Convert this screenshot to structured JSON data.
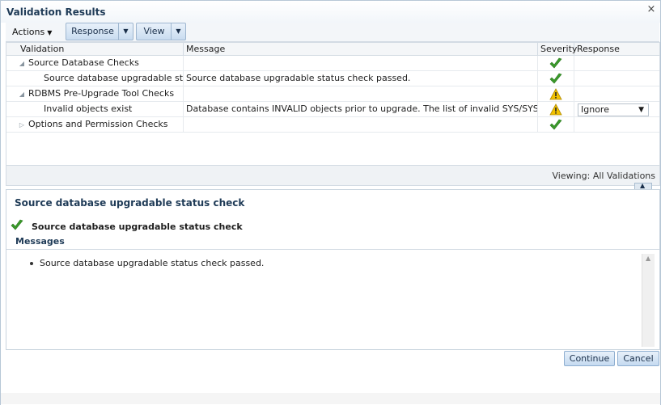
{
  "dialog": {
    "title": "Validation Results",
    "close": "×"
  },
  "toolbar": {
    "actions_label": "Actions",
    "response_label": "Response",
    "view_label": "View"
  },
  "grid": {
    "columns": [
      "Validation",
      "Message",
      "Severity",
      "Response"
    ],
    "rows": [
      {
        "validation": "Source Database Checks",
        "message": "",
        "severity": "passed",
        "response": "",
        "level": 0,
        "expanded": true
      },
      {
        "validation": "Source database upgradable status check",
        "message": "Source database upgradable status check passed.",
        "severity": "passed",
        "response": "",
        "level": 1
      },
      {
        "validation": "RDBMS Pre-Upgrade Tool Checks",
        "message": "",
        "severity": "warning",
        "response": "",
        "level": 0,
        "expanded": true
      },
      {
        "validation": "Invalid objects exist",
        "message": "Database contains INVALID objects prior to upgrade. The list of invalid SYS/SYSTEM ob...",
        "severity": "warning",
        "response": "Ignore",
        "level": 1
      },
      {
        "validation": "Options and Permission Checks",
        "message": "",
        "severity": "passed",
        "response": "",
        "level": 0,
        "expanded": false
      }
    ],
    "viewing": "Viewing: All Validations"
  },
  "detail": {
    "title": "Source database upgradable status check",
    "subtitle": "Source database upgradable status check",
    "messages_heading": "Messages",
    "messages": [
      "Source database upgradable status check passed."
    ]
  },
  "buttons": {
    "continue": "Continue",
    "cancel": "Cancel"
  },
  "colors": {
    "check": "#3a9a2a",
    "warning": "#f2c200",
    "accent": "#1f3b57"
  }
}
